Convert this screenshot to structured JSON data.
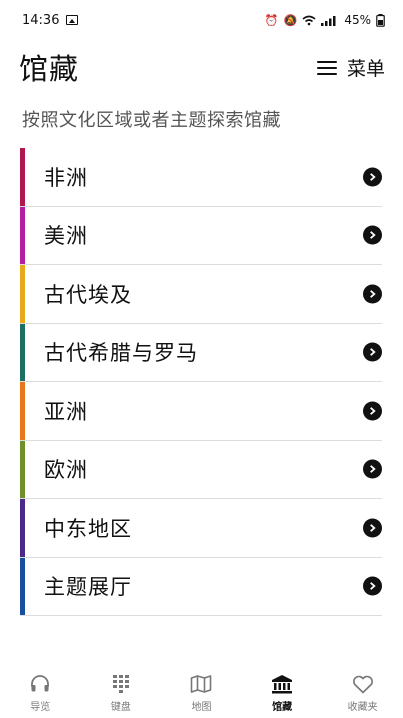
{
  "status_bar": {
    "time": "14:36",
    "battery": "45%"
  },
  "header": {
    "title": "馆藏",
    "menu_label": "菜单"
  },
  "subtitle": "按照文化区域或者主题探索馆藏",
  "collections": [
    {
      "label": "非洲",
      "color": "#b0174f"
    },
    {
      "label": "美洲",
      "color": "#b31fa3"
    },
    {
      "label": "古代埃及",
      "color": "#e8a81b"
    },
    {
      "label": "古代希腊与罗马",
      "color": "#1d6e63"
    },
    {
      "label": "亚洲",
      "color": "#e8761f"
    },
    {
      "label": "欧洲",
      "color": "#6f8f2a"
    },
    {
      "label": "中东地区",
      "color": "#4b2a8a"
    },
    {
      "label": "主题展厅",
      "color": "#1a4fa0"
    }
  ],
  "bottom_nav": [
    {
      "label": "导览",
      "icon": "headphones-icon",
      "active": false
    },
    {
      "label": "键盘",
      "icon": "keypad-icon",
      "active": false
    },
    {
      "label": "地图",
      "icon": "map-icon",
      "active": false
    },
    {
      "label": "馆藏",
      "icon": "museum-icon",
      "active": true
    },
    {
      "label": "收藏夹",
      "icon": "heart-icon",
      "active": false
    }
  ]
}
